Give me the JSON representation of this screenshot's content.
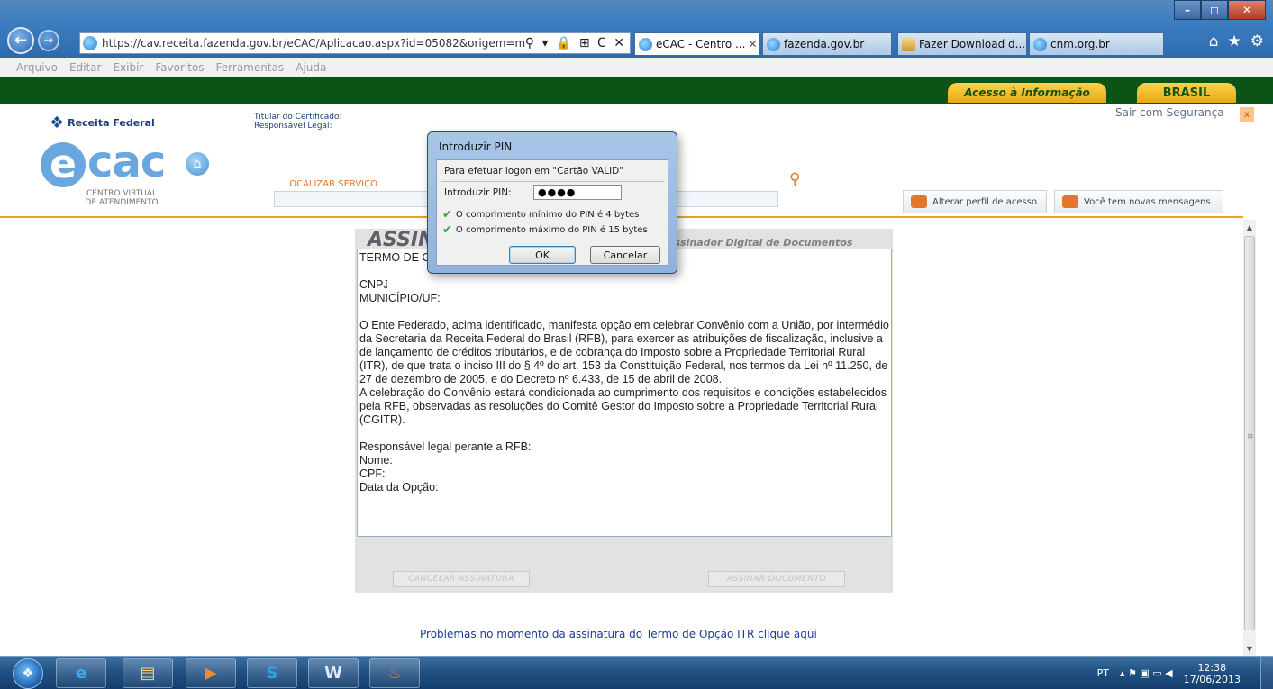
{
  "browser": {
    "url": "https://cav.receita.fazenda.gov.br/eCAC/Aplicacao.aspx?id=05082&origem=menu",
    "address_tools": "⚲ ▾ 🔒 ⊞ C ✕",
    "tabs": [
      {
        "label": "eCAC - Centro ...",
        "close": "✕"
      },
      {
        "label": "fazenda.gov.br"
      },
      {
        "label": "Fazer Download d..."
      },
      {
        "label": "cnm.org.br"
      }
    ],
    "window_buttons": {
      "minimize": "–",
      "maximize": "◻",
      "close": "✕"
    },
    "toolbar_icons": {
      "home": "⌂",
      "favorites": "★",
      "tools": "⚙"
    },
    "menu": [
      "Arquivo",
      "Editar",
      "Exibir",
      "Favoritos",
      "Ferramentas",
      "Ajuda"
    ]
  },
  "gov_bar": {
    "acesso": "Acesso à Informação",
    "brasil": "BRASIL"
  },
  "header": {
    "rf_logo_text": "Receita Federal",
    "ecac_e": "e",
    "ecac_cac": "cac",
    "ecac_sub1": "CENTRO VIRTUAL",
    "ecac_sub2": "DE ATENDIMENTO",
    "cert_label1": "Titular do Certificado:",
    "cert_label2": "Responsável Legal:",
    "logout": "Sair com Segurança",
    "logout_x": "x",
    "search_label": "LOCALIZAR SERVIÇO",
    "profile_btn": "Alterar perfil de acesso",
    "messages_btn": "Você tem novas mensagens"
  },
  "sign": {
    "title": "ASSINAT",
    "subtitle": "Assinador Digital de Documentos",
    "doc_line_1": "TERMO DE OPÇÃO",
    "doc_cnpj": "CNPJ:",
    "doc_municipio": "MUNICÍPIO/UF:",
    "doc_p1": "O Ente Federado, acima identificado, manifesta opção em celebrar Convênio com a União, por intermédio da Secretaria da Receita Federal do Brasil (RFB), para exercer as atribuições de fiscalização, inclusive a de lançamento de créditos tributários, e de cobrança do Imposto sobre a Propriedade Territorial Rural (ITR), de que trata o inciso III do § 4º do art. 153 da Constituição Federal, nos termos da Lei nº 11.250, de 27 de dezembro de 2005, e do Decreto nº 6.433, de 15 de abril de 2008.",
    "doc_p2": "A celebração do Convênio estará condicionada ao cumprimento dos requisitos e condições estabelecidos pela RFB, observadas as resoluções do Comitê Gestor do Imposto sobre a Propriedade Territorial Rural (CGITR).",
    "doc_resp": "Responsável legal perante a RFB:",
    "doc_nome": "Nome:",
    "doc_cpf": "CPF:",
    "doc_data": "Data da Opção:",
    "cancel_btn": "CANCELAR ASSINATURA",
    "sign_btn": "ASSINAR DOCUMENTO",
    "help_text": "Problemas no momento da assinatura do Termo de Opção ITR clique ",
    "help_link": "aqui"
  },
  "pin_dialog": {
    "title": "Introduzir PIN",
    "message": "Para efetuar logon em \"Cartão VALID\"",
    "pin_label": "Introduzir PIN:",
    "pin_value": "●●●●",
    "req_min": "O comprimento mínimo do PIN é 4 bytes",
    "req_max": "O comprimento máximo do PIN é 15 bytes",
    "ok": "OK",
    "cancel": "Cancelar"
  },
  "taskbar": {
    "apps": [
      "e",
      "▤",
      "▶",
      "S",
      "W",
      "♨"
    ],
    "lang": "PT",
    "tray_icons": "▴ ⚑ ▣ ▭ ◀",
    "time": "12:38",
    "date": "17/06/2013"
  }
}
